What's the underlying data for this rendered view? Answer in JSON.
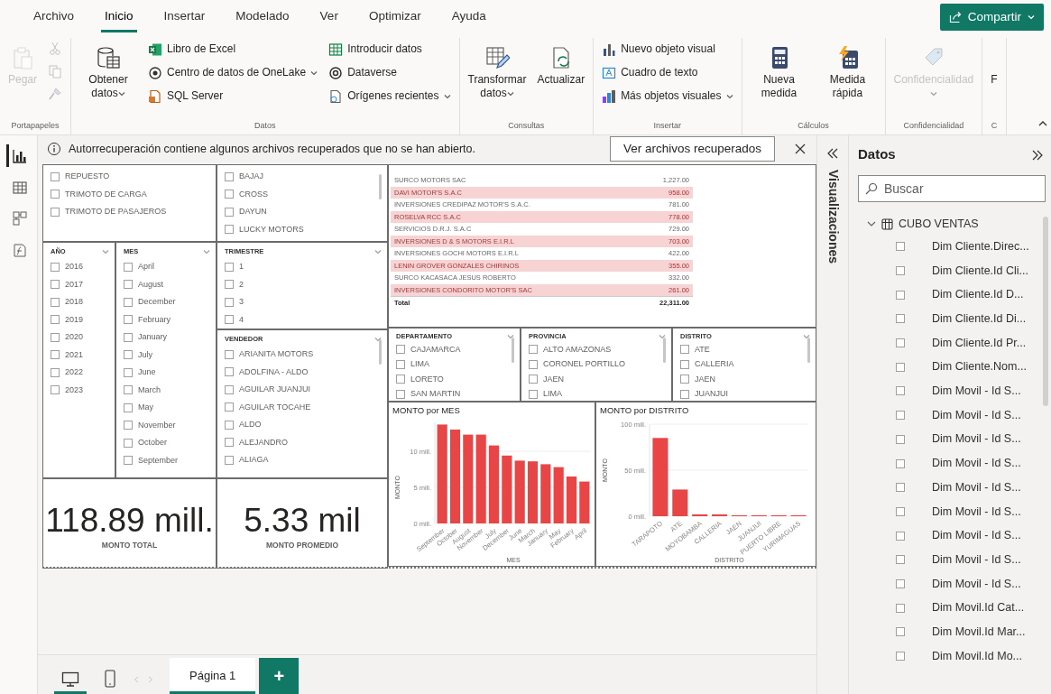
{
  "menu_tabs": [
    {
      "label": "Archivo",
      "selected": false
    },
    {
      "label": "Inicio",
      "selected": true
    },
    {
      "label": "Insertar",
      "selected": false
    },
    {
      "label": "Modelado",
      "selected": false
    },
    {
      "label": "Ver",
      "selected": false
    },
    {
      "label": "Optimizar",
      "selected": false
    },
    {
      "label": "Ayuda",
      "selected": false
    }
  ],
  "share_button": {
    "label": "Compartir"
  },
  "ribbon": [
    {
      "label": "Portapapeles",
      "columns": [
        [
          {
            "kind": "large",
            "label": "Pegar",
            "disabled": true,
            "dropdown": false
          }
        ],
        [
          {
            "kind": "icon",
            "disabled": true
          },
          {
            "kind": "icon",
            "disabled": true
          },
          {
            "kind": "icon",
            "disabled": true
          }
        ]
      ]
    },
    {
      "label": "Datos",
      "columns": [
        [
          {
            "kind": "large",
            "label": "Obtener datos",
            "disabled": false,
            "dropdown": true
          }
        ],
        [
          {
            "kind": "small",
            "label": "Libro de Excel",
            "disabled": false,
            "dropdown": false
          },
          {
            "kind": "small",
            "label": "Centro de datos de OneLake",
            "disabled": false,
            "dropdown": true
          },
          {
            "kind": "small",
            "label": "SQL Server",
            "disabled": false,
            "dropdown": false
          }
        ],
        [
          {
            "kind": "small",
            "label": "Introducir datos",
            "disabled": false,
            "dropdown": false
          },
          {
            "kind": "small",
            "label": "Dataverse",
            "disabled": false,
            "dropdown": false
          },
          {
            "kind": "small",
            "label": "Orígenes recientes",
            "disabled": false,
            "dropdown": true
          }
        ]
      ]
    },
    {
      "label": "Consultas",
      "columns": [
        [
          {
            "kind": "large",
            "label": "Transformar datos",
            "disabled": false,
            "dropdown": true
          }
        ],
        [
          {
            "kind": "large",
            "label": "Actualizar",
            "disabled": false,
            "dropdown": false
          }
        ]
      ]
    },
    {
      "label": "Insertar",
      "columns": [
        [
          {
            "kind": "small",
            "label": "Nuevo objeto visual",
            "disabled": false,
            "dropdown": false
          },
          {
            "kind": "small",
            "label": "Cuadro de texto",
            "disabled": false,
            "dropdown": false
          },
          {
            "kind": "small",
            "label": "Más objetos visuales",
            "disabled": false,
            "dropdown": true
          }
        ]
      ]
    },
    {
      "label": "Cálculos",
      "columns": [
        [
          {
            "kind": "large",
            "label": "Nueva medida",
            "disabled": false,
            "dropdown": false
          }
        ],
        [
          {
            "kind": "large",
            "label": "Medida rápida",
            "disabled": false,
            "dropdown": false
          }
        ]
      ]
    },
    {
      "label": "Confidencialidad",
      "columns": [
        [
          {
            "kind": "large",
            "label": "Confidencialidad",
            "disabled": true,
            "dropdown": true
          }
        ]
      ]
    },
    {
      "label": "C",
      "columns": [
        [
          {
            "kind": "large",
            "label": "F",
            "disabled": false,
            "dropdown": false
          }
        ]
      ]
    }
  ],
  "rail_items": [
    {
      "selected": true
    },
    {
      "selected": false
    },
    {
      "selected": false
    },
    {
      "selected": false
    }
  ],
  "notification": {
    "text": "Autorrecuperación contiene algunos archivos recuperados que no se han abierto.",
    "button": "Ver archivos recuperados"
  },
  "slicers": [
    {
      "scrollable": false,
      "items": [
        {
          "label": "REPUESTO",
          "checked": false
        },
        {
          "label": "TRIMOTO DE CARGA",
          "checked": false
        },
        {
          "label": "TRIMOTO DE PASAJEROS",
          "checked": false
        }
      ]
    },
    {
      "scrollable": true,
      "items": [
        {
          "label": "BAJAJ",
          "checked": false
        },
        {
          "label": "CROSS",
          "checked": false
        },
        {
          "label": "DAYUN",
          "checked": false
        },
        {
          "label": "LUCKY MOTORS",
          "checked": false
        }
      ]
    },
    {
      "title": "AÑO",
      "scrollable": false,
      "items": [
        {
          "label": "2016",
          "checked": false
        },
        {
          "label": "2017",
          "checked": false
        },
        {
          "label": "2018",
          "checked": false
        },
        {
          "label": "2019",
          "checked": false
        },
        {
          "label": "2020",
          "checked": false
        },
        {
          "label": "2021",
          "checked": false
        },
        {
          "label": "2022",
          "checked": false
        },
        {
          "label": "2023",
          "checked": false
        }
      ]
    },
    {
      "title": "MES",
      "scrollable": false,
      "items": [
        {
          "label": "April",
          "checked": false
        },
        {
          "label": "August",
          "checked": false
        },
        {
          "label": "December",
          "checked": false
        },
        {
          "label": "February",
          "checked": false
        },
        {
          "label": "January",
          "checked": false
        },
        {
          "label": "July",
          "checked": false
        },
        {
          "label": "June",
          "checked": false
        },
        {
          "label": "March",
          "checked": false
        },
        {
          "label": "May",
          "checked": false
        },
        {
          "label": "November",
          "checked": false
        },
        {
          "label": "October",
          "checked": false
        },
        {
          "label": "September",
          "checked": false
        }
      ]
    },
    {
      "title": "TRIMESTRE",
      "scrollable": false,
      "items": [
        {
          "label": "1",
          "checked": false
        },
        {
          "label": "2",
          "checked": false
        },
        {
          "label": "3",
          "checked": false
        },
        {
          "label": "4",
          "checked": false
        }
      ]
    },
    {
      "title": "VENDEDOR",
      "scrollable": true,
      "items": [
        {
          "label": "ARIANITA MOTORS",
          "checked": false
        },
        {
          "label": "ADOLFINA - ALDO",
          "checked": false
        },
        {
          "label": "AGUILAR JUANJUI",
          "checked": false
        },
        {
          "label": "AGUILAR TOCAHE",
          "checked": false
        },
        {
          "label": "ALDO",
          "checked": false
        },
        {
          "label": "ALEJANDRO",
          "checked": false
        },
        {
          "label": "ALIAGA",
          "checked": false
        }
      ]
    }
  ],
  "kpis": [
    {
      "value": "118.89 mill.",
      "label": "MONTO TOTAL"
    },
    {
      "value": "5.33 mil",
      "label": "MONTO PROMEDIO"
    }
  ],
  "table": {
    "rows": [
      {
        "name": "SURCO MOTORS SAC",
        "amount": "1,227.00",
        "highlighted": false
      },
      {
        "name": "DAVI MOTOR'S S.A.C",
        "amount": "958.00",
        "highlighted": true
      },
      {
        "name": "INVERSIONES CREDIPAZ MOTOR'S S.A.C.",
        "amount": "781.00",
        "highlighted": false
      },
      {
        "name": "ROSELVA RCC S.A.C",
        "amount": "778.00",
        "highlighted": true
      },
      {
        "name": "SERVICIOS D.R.J. S.A.C",
        "amount": "729.00",
        "highlighted": false
      },
      {
        "name": "INVERSIONES D & S MOTORS E.I.R.L",
        "amount": "703.00",
        "highlighted": true
      },
      {
        "name": "INVERSIONES GOCHI MOTORS E.I.R.L",
        "amount": "422.00",
        "highlighted": false
      },
      {
        "name": "LENIN GROVER GONZALES CHIRINOS",
        "amount": "355.00",
        "highlighted": true
      },
      {
        "name": "SURCO KACASACA JESUS ROBERTO",
        "amount": "332.00",
        "highlighted": false
      },
      {
        "name": "INVERSIONES CONDORITO MOTOR'S SAC",
        "amount": "261.00",
        "highlighted": true
      }
    ],
    "total": {
      "label": "Total",
      "amount": "22,311.00"
    }
  },
  "location_slicers": [
    {
      "title": "DEPARTAMENTO",
      "scrollable": true,
      "items": [
        {
          "label": "CAJAMARCA",
          "checked": false
        },
        {
          "label": "LIMA",
          "checked": false
        },
        {
          "label": "LORETO",
          "checked": false
        },
        {
          "label": "SAN MARTIN",
          "checked": false
        }
      ]
    },
    {
      "title": "PROVINCIA",
      "scrollable": true,
      "items": [
        {
          "label": "ALTO AMAZONAS",
          "checked": false
        },
        {
          "label": "CORONEL PORTILLO",
          "checked": false
        },
        {
          "label": "JAEN",
          "checked": false
        },
        {
          "label": "LIMA",
          "checked": false
        }
      ]
    },
    {
      "title": "DISTRITO",
      "scrollable": true,
      "items": [
        {
          "label": "ATE",
          "checked": false
        },
        {
          "label": "CALLERIA",
          "checked": false
        },
        {
          "label": "JAEN",
          "checked": false
        },
        {
          "label": "JUANJUI",
          "checked": false
        }
      ]
    }
  ],
  "charts": [
    {
      "chart_data": {
        "type": "bar",
        "title": "MONTO por MES",
        "xlabel": "MES",
        "ylabel": "MONTO",
        "categories": [
          "September",
          "October",
          "August",
          "November",
          "July",
          "December",
          "June",
          "March",
          "January",
          "May",
          "February",
          "April"
        ],
        "series": [
          {
            "color": "#e84646",
            "values": [
              13.7,
              13.0,
              12.3,
              12.3,
              10.8,
              9.4,
              8.7,
              8.6,
              8.2,
              7.8,
              6.5,
              5.8
            ]
          }
        ],
        "ylim": [
          0,
          14
        ],
        "yticks": [
          {
            "value": 0,
            "label": "0 mill."
          },
          {
            "value": 5,
            "label": "5 mill."
          },
          {
            "value": 10,
            "label": "10 mill."
          }
        ]
      }
    },
    {
      "chart_data": {
        "type": "bar",
        "title": "MONTO por DISTRITO",
        "xlabel": "DISTRITO",
        "ylabel": "MONTO",
        "categories": [
          "TARAPOTO",
          "ATE",
          "MOYOBAMBA",
          "CALLERIA",
          "JAEN",
          "JUANJUI",
          "PUERTO LIBRE",
          "YURIMAGUAS"
        ],
        "series": [
          {
            "color": "#e84646",
            "values": [
              85,
              29,
              2,
              2,
              1,
              1,
              1,
              1
            ]
          }
        ],
        "ylim": [
          0,
          100
        ],
        "yticks": [
          {
            "value": 0,
            "label": "0 mill."
          },
          {
            "value": 50,
            "label": "50 mill."
          },
          {
            "value": 100,
            "label": "100 mill."
          }
        ]
      }
    }
  ],
  "layout_views": [
    {
      "selected": true
    },
    {
      "selected": false
    }
  ],
  "page_tabs": [
    {
      "label": "Página 1",
      "selected": true
    }
  ],
  "add_page_button": {
    "label": "+"
  },
  "visualizations_pane": {
    "title": "Visualizaciones"
  },
  "data_pane": {
    "title": "Datos",
    "search": {
      "placeholder": "Buscar"
    },
    "tree": [
      {
        "label": "CUBO VENTAS",
        "expanded": true,
        "children": [
          {
            "label": "Dim Cliente.Direc...",
            "checked": false
          },
          {
            "label": "Dim Cliente.Id Cli...",
            "checked": false
          },
          {
            "label": "Dim Cliente.Id D...",
            "checked": false
          },
          {
            "label": "Dim Cliente.Id Di...",
            "checked": false
          },
          {
            "label": "Dim Cliente.Id Pr...",
            "checked": false
          },
          {
            "label": "Dim Cliente.Nom...",
            "checked": false
          },
          {
            "label": "Dim Movil - Id S...",
            "checked": false
          },
          {
            "label": "Dim Movil - Id S...",
            "checked": false
          },
          {
            "label": "Dim Movil - Id S...",
            "checked": false
          },
          {
            "label": "Dim Movil - Id S...",
            "checked": false
          },
          {
            "label": "Dim Movil - Id S...",
            "checked": false
          },
          {
            "label": "Dim Movil - Id S...",
            "checked": false
          },
          {
            "label": "Dim Movil - Id S...",
            "checked": false
          },
          {
            "label": "Dim Movil - Id S...",
            "checked": false
          },
          {
            "label": "Dim Movil - Id S...",
            "checked": false
          },
          {
            "label": "Dim Movil.Id Cat...",
            "checked": false
          },
          {
            "label": "Dim Movil.Id Mar...",
            "checked": false
          },
          {
            "label": "Dim Movil.Id Mo...",
            "checked": false
          }
        ]
      }
    ]
  }
}
